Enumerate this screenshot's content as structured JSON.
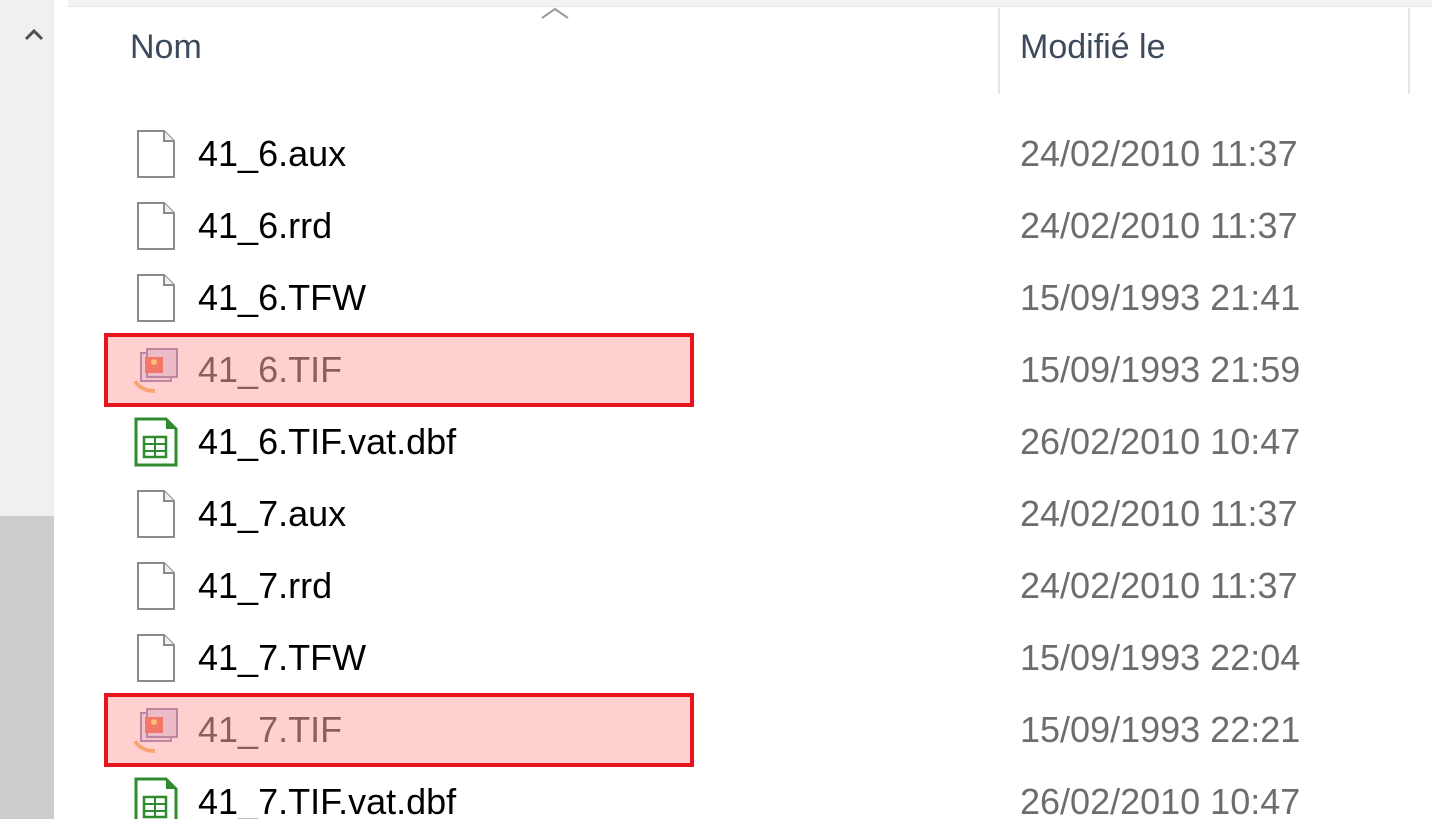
{
  "header": {
    "name_label": "Nom",
    "date_label": "Modifié le",
    "sort_indicator": "chevron-up-icon"
  },
  "scrollbar": {
    "up_icon": "chevron-up-icon"
  },
  "files": [
    {
      "name": "41_6.aux",
      "date": "24/02/2010 11:37",
      "icon": "generic-file-icon",
      "highlighted": false
    },
    {
      "name": "41_6.rrd",
      "date": "24/02/2010 11:37",
      "icon": "generic-file-icon",
      "highlighted": false
    },
    {
      "name": "41_6.TFW",
      "date": "15/09/1993 21:41",
      "icon": "generic-file-icon",
      "highlighted": false
    },
    {
      "name": "41_6.TIF",
      "date": "15/09/1993 21:59",
      "icon": "image-file-icon",
      "highlighted": true
    },
    {
      "name": "41_6.TIF.vat.dbf",
      "date": "26/02/2010 10:47",
      "icon": "spreadsheet-file-icon",
      "highlighted": false
    },
    {
      "name": "41_7.aux",
      "date": "24/02/2010 11:37",
      "icon": "generic-file-icon",
      "highlighted": false
    },
    {
      "name": "41_7.rrd",
      "date": "24/02/2010 11:37",
      "icon": "generic-file-icon",
      "highlighted": false
    },
    {
      "name": "41_7.TFW",
      "date": "15/09/1993 22:04",
      "icon": "generic-file-icon",
      "highlighted": false
    },
    {
      "name": "41_7.TIF",
      "date": "15/09/1993 22:21",
      "icon": "image-file-icon",
      "highlighted": true
    },
    {
      "name": "41_7.TIF.vat.dbf",
      "date": "26/02/2010 10:47",
      "icon": "spreadsheet-file-icon",
      "highlighted": false
    }
  ],
  "colors": {
    "highlight_border": "#e8141c",
    "highlight_fill": "#ffaaaa",
    "date_text": "#6d6d6d",
    "header_text": "#3c4a5c"
  }
}
